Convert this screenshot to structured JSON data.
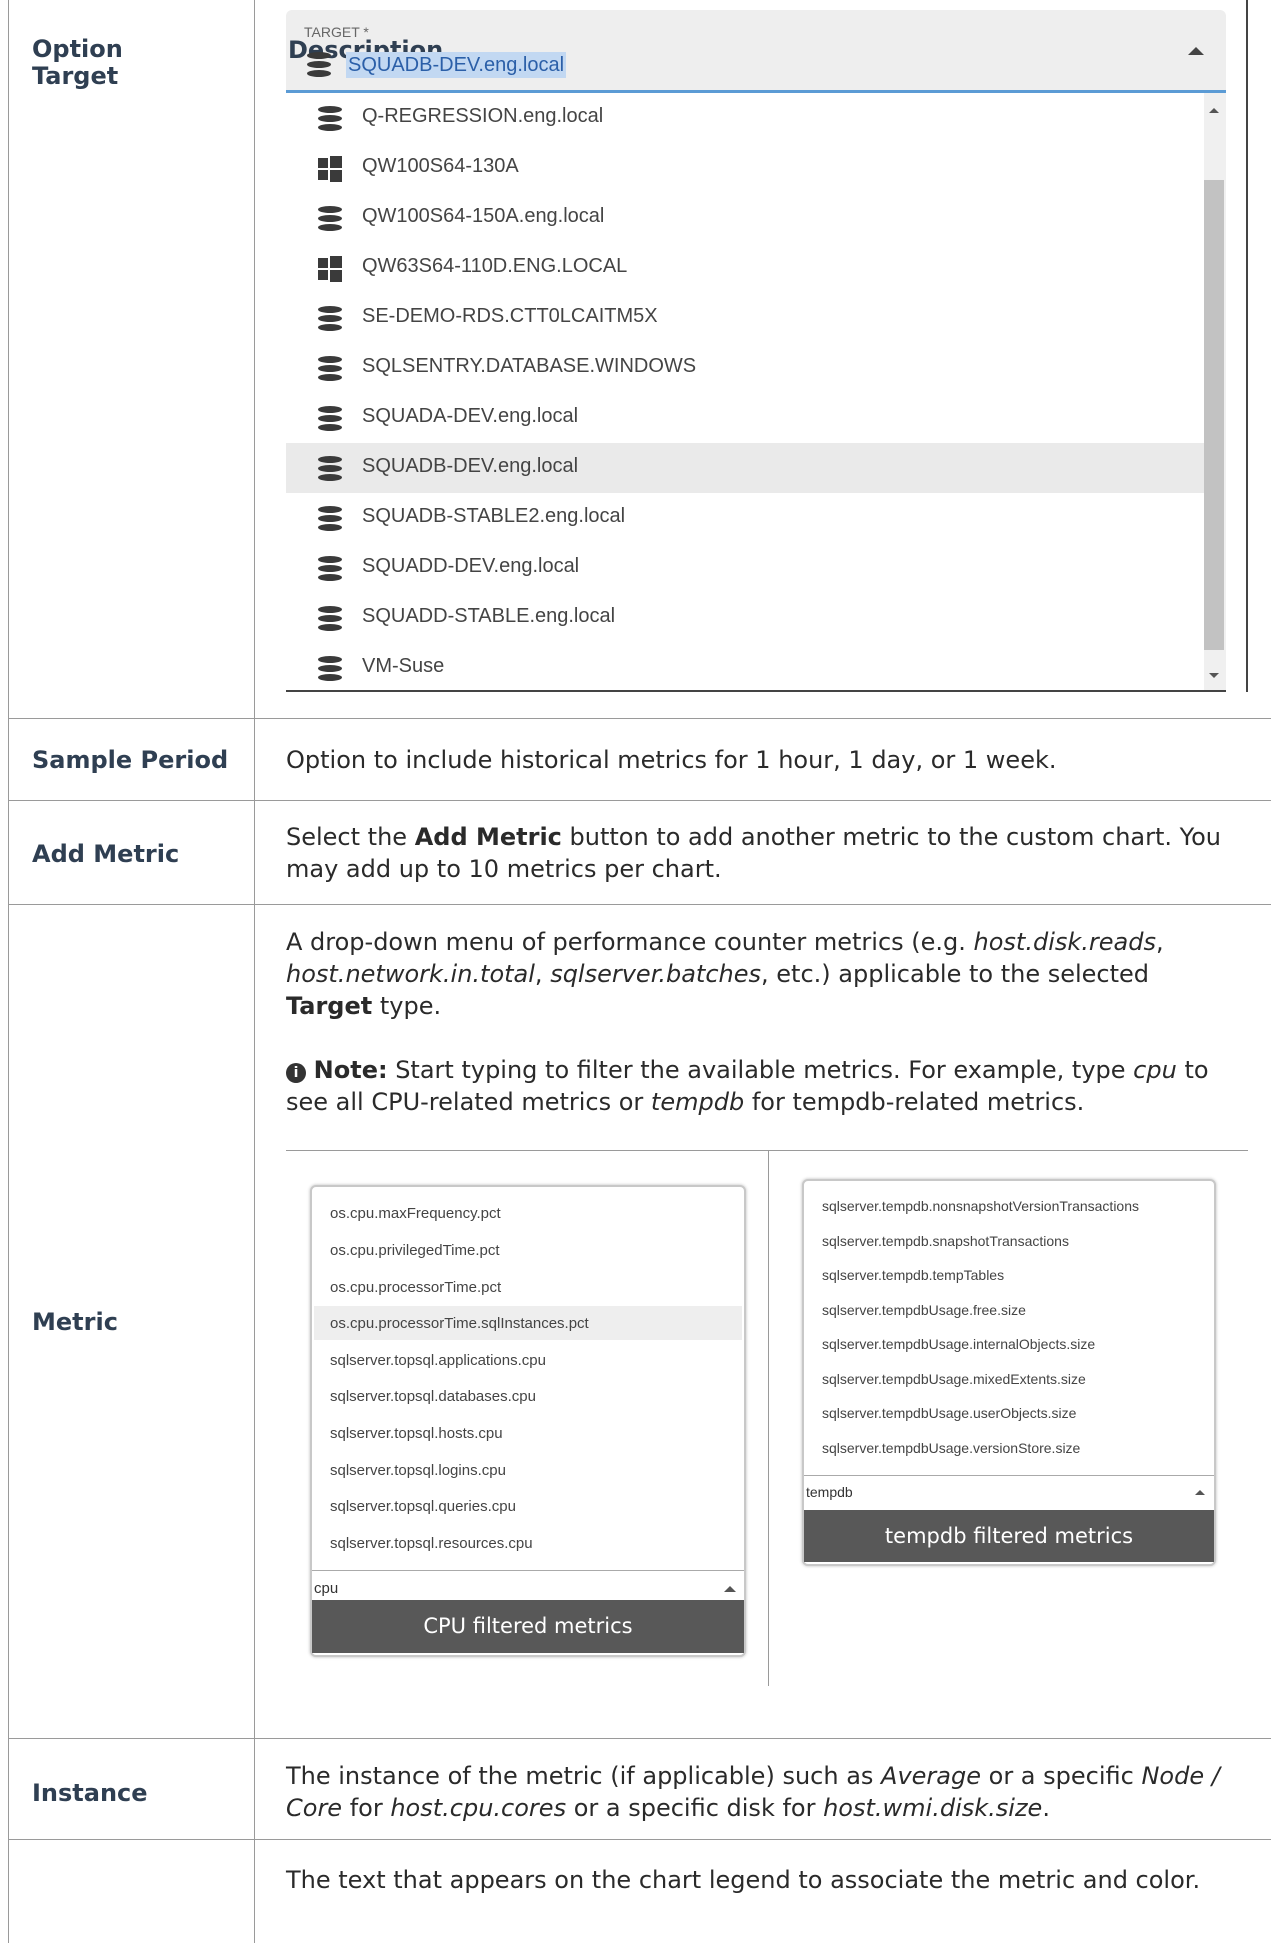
{
  "table": {
    "header": {
      "option_line1": "Option",
      "option_line2": "Target",
      "description": "Description"
    },
    "target_dropdown": {
      "label": "TARGET *",
      "value": "SQUADB-DEV.eng.local",
      "items": [
        {
          "label": "Q-REGRESSION.eng.local",
          "icon": "database-icon"
        },
        {
          "label": "QW100S64-130A",
          "icon": "windows-icon"
        },
        {
          "label": "QW100S64-150A.eng.local",
          "icon": "database-icon"
        },
        {
          "label": "QW63S64-110D.ENG.LOCAL",
          "icon": "windows-icon"
        },
        {
          "label": "SE-DEMO-RDS.CTT0LCAITM5X",
          "icon": "database-icon"
        },
        {
          "label": "SQLSENTRY.DATABASE.WINDOWS",
          "icon": "database-icon"
        },
        {
          "label": "SQUADA-DEV.eng.local",
          "icon": "database-icon"
        },
        {
          "label": "SQUADB-DEV.eng.local",
          "icon": "database-icon",
          "selected": true
        },
        {
          "label": "SQUADB-STABLE2.eng.local",
          "icon": "database-icon"
        },
        {
          "label": "SQUADD-DEV.eng.local",
          "icon": "database-icon"
        },
        {
          "label": "SQUADD-STABLE.eng.local",
          "icon": "database-icon"
        },
        {
          "label": "VM-Suse",
          "icon": "database-icon"
        }
      ]
    },
    "sample_period": {
      "name": "Sample Period",
      "description": "Option to include historical metrics for 1 hour, 1 day, or 1 week."
    },
    "add_metric": {
      "name": "Add Metric",
      "desc_pre": "Select the ",
      "desc_bold": "Add Metric",
      "desc_post": " button to add another metric to the custom chart. You may add up to 10 metrics per chart."
    },
    "metric": {
      "name": "Metric",
      "p1_a": "A drop-down menu of performance counter metrics (e.g. ",
      "p1_i1": "host.disk.reads",
      "p1_b": ", ",
      "p1_i2": "host.network.in.total",
      "p1_c": ", ",
      "p1_i3": "sqlserver.batches",
      "p1_d": ", etc.) applicable to the selected ",
      "p1_bold": "Target",
      "p1_e": " type.",
      "note_label": "Note:",
      "note_a": "  Start typing to filter the available metrics. For example, type ",
      "note_i1": "cpu",
      "note_b": " to see all CPU-related metrics or ",
      "note_i2": "tempdb",
      "note_c": " for tempdb-related metrics.",
      "cpu_panel": {
        "items": [
          "os.cpu.maxFrequency.pct",
          "os.cpu.privilegedTime.pct",
          "os.cpu.processorTime.pct",
          "os.cpu.processorTime.sqlInstances.pct",
          "sqlserver.topsql.applications.cpu",
          "sqlserver.topsql.databases.cpu",
          "sqlserver.topsql.hosts.cpu",
          "sqlserver.topsql.logins.cpu",
          "sqlserver.topsql.queries.cpu",
          "sqlserver.topsql.resources.cpu"
        ],
        "filter": "cpu",
        "caption": "CPU filtered metrics"
      },
      "tempdb_panel": {
        "items": [
          "sqlserver.tempdb.nonsnapshotVersionTransactions",
          "sqlserver.tempdb.snapshotTransactions",
          "sqlserver.tempdb.tempTables",
          "sqlserver.tempdbUsage.free.size",
          "sqlserver.tempdbUsage.internalObjects.size",
          "sqlserver.tempdbUsage.mixedExtents.size",
          "sqlserver.tempdbUsage.userObjects.size",
          "sqlserver.tempdbUsage.versionStore.size"
        ],
        "filter": "tempdb",
        "caption": "tempdb filtered metrics"
      }
    },
    "instance": {
      "name": "Instance",
      "a": "The instance of the metric (if applicable) such as ",
      "i1": "Average",
      "b": " or a specific ",
      "i2": "Node / Core",
      "c": " for ",
      "i3": "host.cpu.cores",
      "d": " or a specific disk for ",
      "i4": "host.wmi.disk.size",
      "e": "."
    },
    "legend": {
      "description": "The text that appears on the chart legend to associate the metric and color."
    }
  }
}
